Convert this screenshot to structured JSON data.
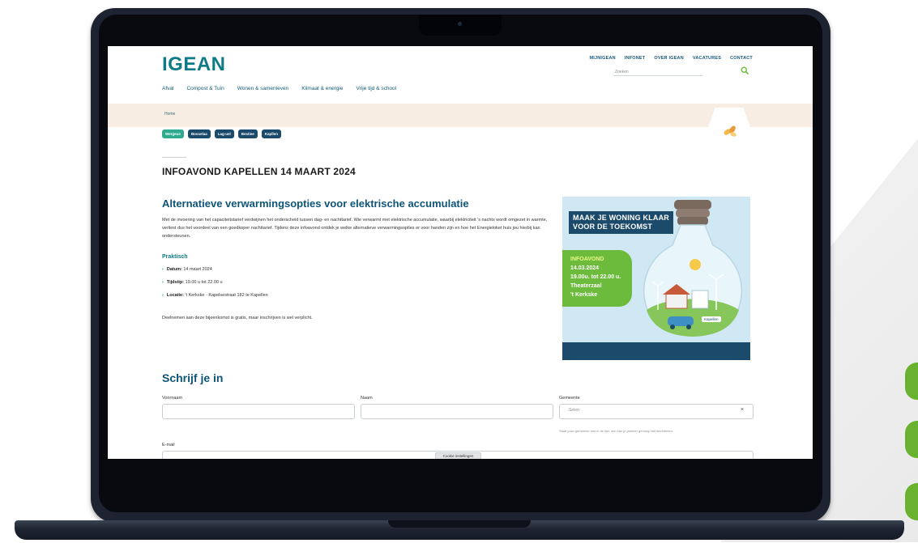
{
  "header": {
    "logo": "IGEAN",
    "utility_nav": [
      "MIJNIGEAN",
      "INFONET",
      "OVER IGEAN",
      "VACATURES",
      "CONTACT"
    ],
    "search_placeholder": "Zoeken",
    "main_nav": [
      "Afval",
      "Compost & Tuin",
      "Wonen & samenleven",
      "Klimaat & energie",
      "Vrije tijd & school"
    ]
  },
  "breadcrumb": "Home",
  "tags": [
    {
      "label": "Wergeus",
      "active": true
    },
    {
      "label": "Bosselaa",
      "active": false
    },
    {
      "label": "Lag-uel",
      "active": false
    },
    {
      "label": "Bestiee",
      "active": false
    },
    {
      "label": "Kapllen",
      "active": false
    }
  ],
  "page_title": "INFOAVOND KAPELLEN 14 MAART 2024",
  "article": {
    "heading": "Alternatieve verwarmingsopties voor elektrische accumulatie",
    "paragraph": "Met de invoering van het capaciteitstarief verdwijnen het onderscheid tussen dag- en nachttarief. Wie verwarmt met elektrische accumulatie, waarbij elektriciteit 's nachts wordt omgezet in warmte, verliest dus het voordeel van een goedkoper nachttarief. Tijdens deze infoavond ontdek je welke alternatieve verwarmingsopties er voor handen zijn en hoe het Energieloket huis jou hierbij kan ondersteunen.",
    "praktisch_heading": "Praktisch",
    "details": [
      {
        "label": "Datum:",
        "value": "14 maart 2024"
      },
      {
        "label": "Tijdstip:",
        "value": "19.00 u tot 22.00 u"
      },
      {
        "label": "Locatie:",
        "value": "'t Kerkske - Kapelsestraat 182 te Kapellen"
      }
    ],
    "note": "Deelnemen aan deze bijeenkomst is gratis, maar inschrijven is wel verplicht."
  },
  "poster": {
    "headline_line1": "MAAK JE WONING KLAAR",
    "headline_line2": "VOOR DE TOEKOMST",
    "event_label": "INFOAVOND",
    "event_date": "14.03.2024",
    "event_time": "19.00u. tot 22.00 u.",
    "event_venue1": "Theaterzaal",
    "event_venue2": "'t Kerkske",
    "place_label": "Kapellen",
    "colors": {
      "dark_blue": "#1c4a6a",
      "green": "#6dbb3c",
      "sky": "#cfe8f4"
    }
  },
  "form": {
    "title": "Schrijf je in",
    "first_name_label": "Voornaam",
    "last_name_label": "Naam",
    "municipality_label": "Gemeente",
    "municipality_value": "Selen",
    "municipality_help": "Staat jouw gemeente niet in de lijst, dan kan je jammer genoeg niet deelnemen.",
    "email_label": "E-mail",
    "cookie_button": "Cookie instellingen"
  },
  "colors": {
    "brand_teal": "#0e7c86",
    "nav_blue": "#0e5c7a",
    "tag_dark": "#1c4a6a",
    "tag_active": "#2faa8e",
    "breadcrumb_bg": "#f8ede2",
    "laptop_body": "#1d2331",
    "accent_green": "#69b12f"
  }
}
